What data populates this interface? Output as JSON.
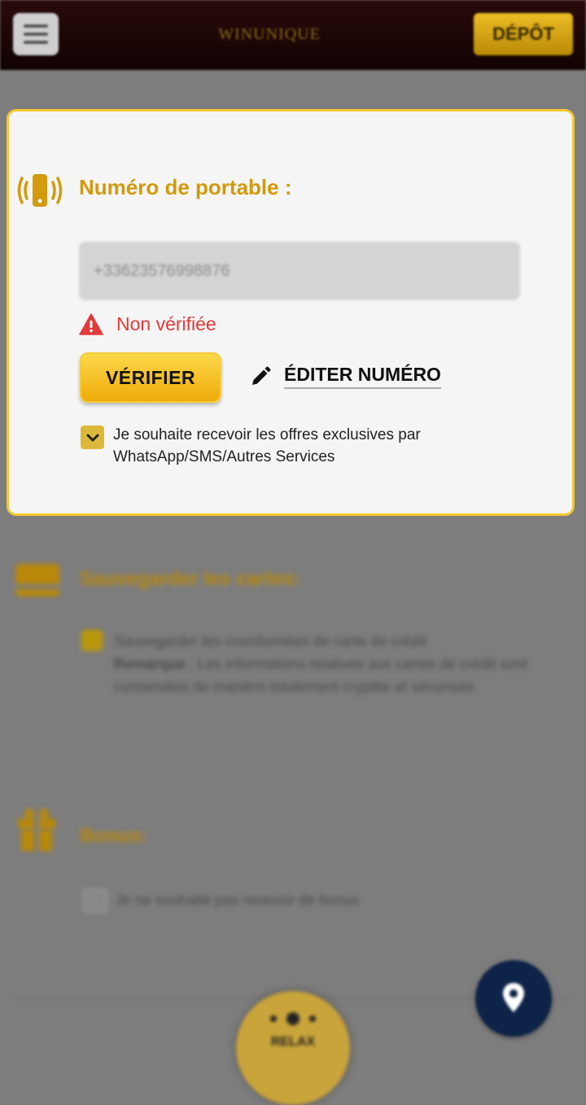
{
  "header": {
    "logo_text": "WINUNIQUE",
    "deposit_label": "DÉPÔT"
  },
  "modal": {
    "title": "Numéro de portable :",
    "phone_value": "+33623576998876",
    "status_text": "Non vérifiée",
    "verify_label": "VÉRIFIER",
    "edit_label": "ÉDITER NUMÉRO",
    "opt_in_text": "Je souhaite recevoir les offres exclusives par WhatsApp/SMS/Autres Services"
  },
  "background": {
    "cards_title": "Sauvegarder les cartes:",
    "cards_line1": "Sauvegarder les coordonnées de carte de crédit",
    "cards_note_label": "Remarque",
    "cards_note_text": " : Les informations relatives aux cartes de crédit sont conservées de manière totalement cryptée et sécurisée.",
    "bonus_title": "Bonus:",
    "bonus_text": "Je ne souhaite pas recevoir de bonus",
    "relax_label": "RELAX"
  },
  "colors": {
    "gold": "#d29a0c",
    "warning_red": "#e23a3a",
    "modal_border": "#f2c832"
  }
}
